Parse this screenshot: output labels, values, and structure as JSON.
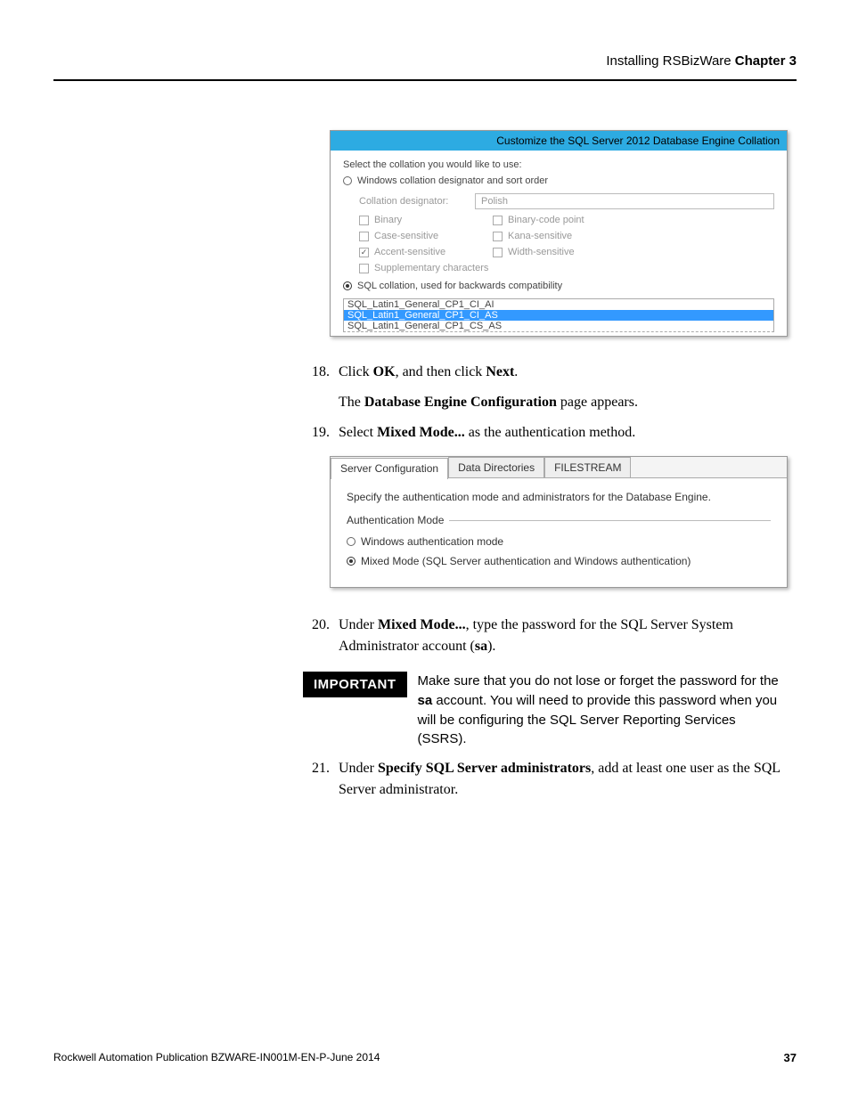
{
  "header": {
    "section": "Installing RSBizWare",
    "chapter": " Chapter 3"
  },
  "collation_dialog": {
    "title": "Customize the SQL Server 2012 Database Engine Collation",
    "intro": "Select the collation you would like to use:",
    "radio_windows": "Windows collation designator and sort order",
    "designator_label": "Collation designator:",
    "designator_value": "Polish",
    "checks": {
      "binary": "Binary",
      "binary_code": "Binary-code point",
      "case_sens": "Case-sensitive",
      "kana_sens": "Kana-sensitive",
      "accent_sens": "Accent-sensitive",
      "width_sens": "Width-sensitive",
      "supplementary": "Supplementary characters"
    },
    "radio_sql": "SQL collation, used for backwards compatibility",
    "list": {
      "item1": "SQL_Latin1_General_CP1_CI_AI",
      "item2": "SQL_Latin1_General_CP1_CI_AS",
      "item3": "SQL_Latin1_General_CP1_CS_AS"
    }
  },
  "steps": {
    "s18": {
      "num": "18.",
      "pre": "Click ",
      "b1": "OK",
      "mid": ", and then click ",
      "b2": "Next",
      "post": "."
    },
    "s18_sub": {
      "pre": "The ",
      "b": "Database Engine Configuration",
      "post": " page appears."
    },
    "s19": {
      "num": "19.",
      "pre": "Select ",
      "b": "Mixed Mode...",
      "post": " as the authentication method."
    },
    "s20": {
      "num": "20.",
      "pre": "Under ",
      "b1": "Mixed Mode...",
      "mid": ", type the password for the SQL Server System Administrator account (",
      "b2": "sa",
      "post": ")."
    },
    "s21": {
      "num": "21.",
      "pre": "Under ",
      "b": "Specify SQL Server administrators",
      "post": ", add at least one user as the SQL Server administrator."
    }
  },
  "auth_dialog": {
    "tabs": {
      "t1": "Server Configuration",
      "t2": "Data Directories",
      "t3": "FILESTREAM"
    },
    "specify": "Specify the authentication mode and administrators for the Database Engine.",
    "auth_mode": "Authentication Mode",
    "radio_win": "Windows authentication mode",
    "radio_mixed": "Mixed Mode (SQL Server authentication and Windows authentication)"
  },
  "important": {
    "badge": "IMPORTANT",
    "pre": "Make sure that you do not lose or forget the password for the ",
    "b": "sa",
    "post": " account. You will need to provide this password when you will be configuring the SQL Server Reporting Services (SSRS)."
  },
  "footer": {
    "pub": "Rockwell Automation Publication BZWARE-IN001M-EN-P-June 2014",
    "page": "37"
  }
}
